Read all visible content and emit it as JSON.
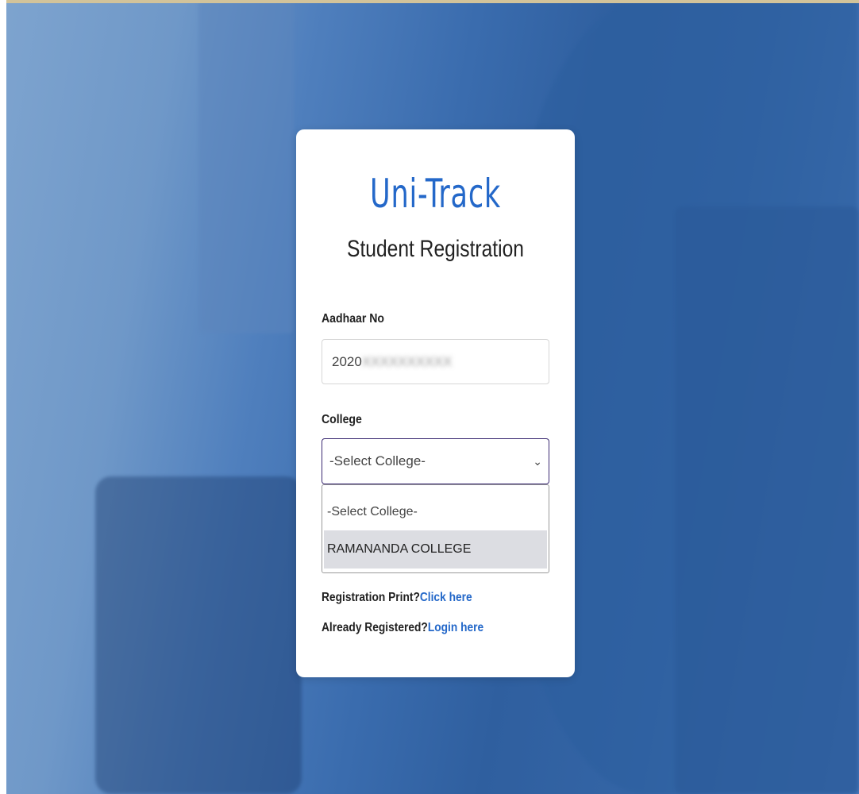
{
  "app": {
    "brand": "Uni-Track",
    "subtitle": "Student Registration"
  },
  "form": {
    "aadhaar_label": "Aadhaar No",
    "aadhaar_value": "2020",
    "college_label": "College",
    "college_selected": "-Select College-",
    "college_options": [
      "-Select College-",
      "RAMANANDA COLLEGE"
    ]
  },
  "links": {
    "print_prefix": "Registration Print?",
    "print_link": "Click here",
    "login_prefix": "Already Registered?",
    "login_link": "Login here"
  },
  "colors": {
    "brand": "#2468c9",
    "link": "#2468c9",
    "select_border": "#3b2a72"
  }
}
